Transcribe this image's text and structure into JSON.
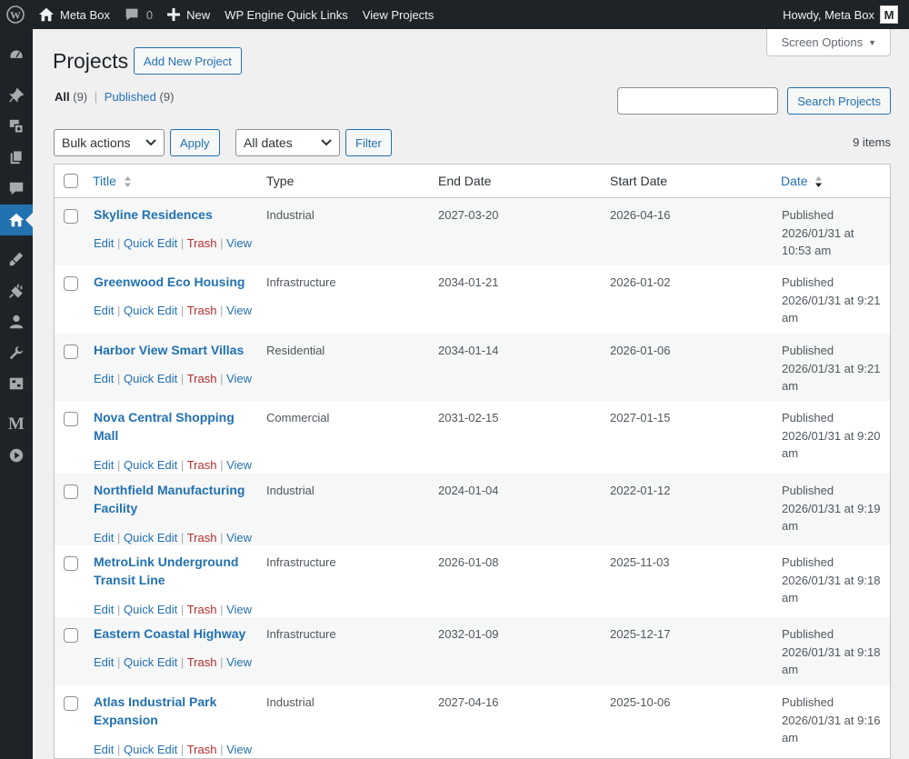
{
  "adminbar": {
    "site_name": "Meta Box",
    "comments_count": "0",
    "new_label": "New",
    "wpengine_label": "WP Engine Quick Links",
    "view_projects_label": "View Projects",
    "howdy": "Howdy, Meta Box",
    "avatar_letter": "M"
  },
  "screen_options": "Screen Options",
  "page": {
    "title": "Projects",
    "add_new": "Add New Project"
  },
  "views": {
    "all": "All",
    "all_count": "(9)",
    "separator": "|",
    "published": "Published",
    "published_count": "(9)"
  },
  "search": {
    "button": "Search Projects"
  },
  "tablenav": {
    "bulk_actions": "Bulk actions",
    "apply": "Apply",
    "all_dates": "All dates",
    "filter": "Filter",
    "items": "9 items"
  },
  "columns": {
    "title": "Title",
    "type": "Type",
    "end_date": "End Date",
    "start_date": "Start Date",
    "date": "Date"
  },
  "row_actions": {
    "edit": "Edit",
    "quick_edit": "Quick Edit",
    "trash": "Trash",
    "view": "View",
    "sep": "|"
  },
  "rows": [
    {
      "title": "Skyline Residences",
      "type": "Industrial",
      "end": "2027-03-20",
      "start": "2026-04-16",
      "status": "Published",
      "date": "2026/01/31 at 10:53 am"
    },
    {
      "title": "Greenwood Eco Housing",
      "type": "Infrastructure",
      "end": "2034-01-21",
      "start": "2026-01-02",
      "status": "Published",
      "date": "2026/01/31 at 9:21 am"
    },
    {
      "title": "Harbor View Smart Villas",
      "type": "Residential",
      "end": "2034-01-14",
      "start": "2026-01-06",
      "status": "Published",
      "date": "2026/01/31 at 9:21 am"
    },
    {
      "title": "Nova Central Shopping Mall",
      "type": "Commercial",
      "end": "2031-02-15",
      "start": "2027-01-15",
      "status": "Published",
      "date": "2026/01/31 at 9:20 am"
    },
    {
      "title": "Northfield Manufacturing Facility",
      "type": "Industrial",
      "end": "2024-01-04",
      "start": "2022-01-12",
      "status": "Published",
      "date": "2026/01/31 at 9:19 am"
    },
    {
      "title": "MetroLink Underground Transit Line",
      "type": "Infrastructure",
      "end": "2026-01-08",
      "start": "2025-11-03",
      "status": "Published",
      "date": "2026/01/31 at 9:18 am"
    },
    {
      "title": "Eastern Coastal Highway",
      "type": "Infrastructure",
      "end": "2032-01-09",
      "start": "2025-12-17",
      "status": "Published",
      "date": "2026/01/31 at 9:18 am"
    },
    {
      "title": "Atlas Industrial Park Expansion",
      "type": "Industrial",
      "end": "2027-04-16",
      "start": "2025-10-06",
      "status": "Published",
      "date": "2026/01/31 at 9:16 am"
    }
  ],
  "colors": {
    "accent": "#2271b1",
    "adminbar": "#1d2327",
    "trash": "#b32d2e"
  }
}
